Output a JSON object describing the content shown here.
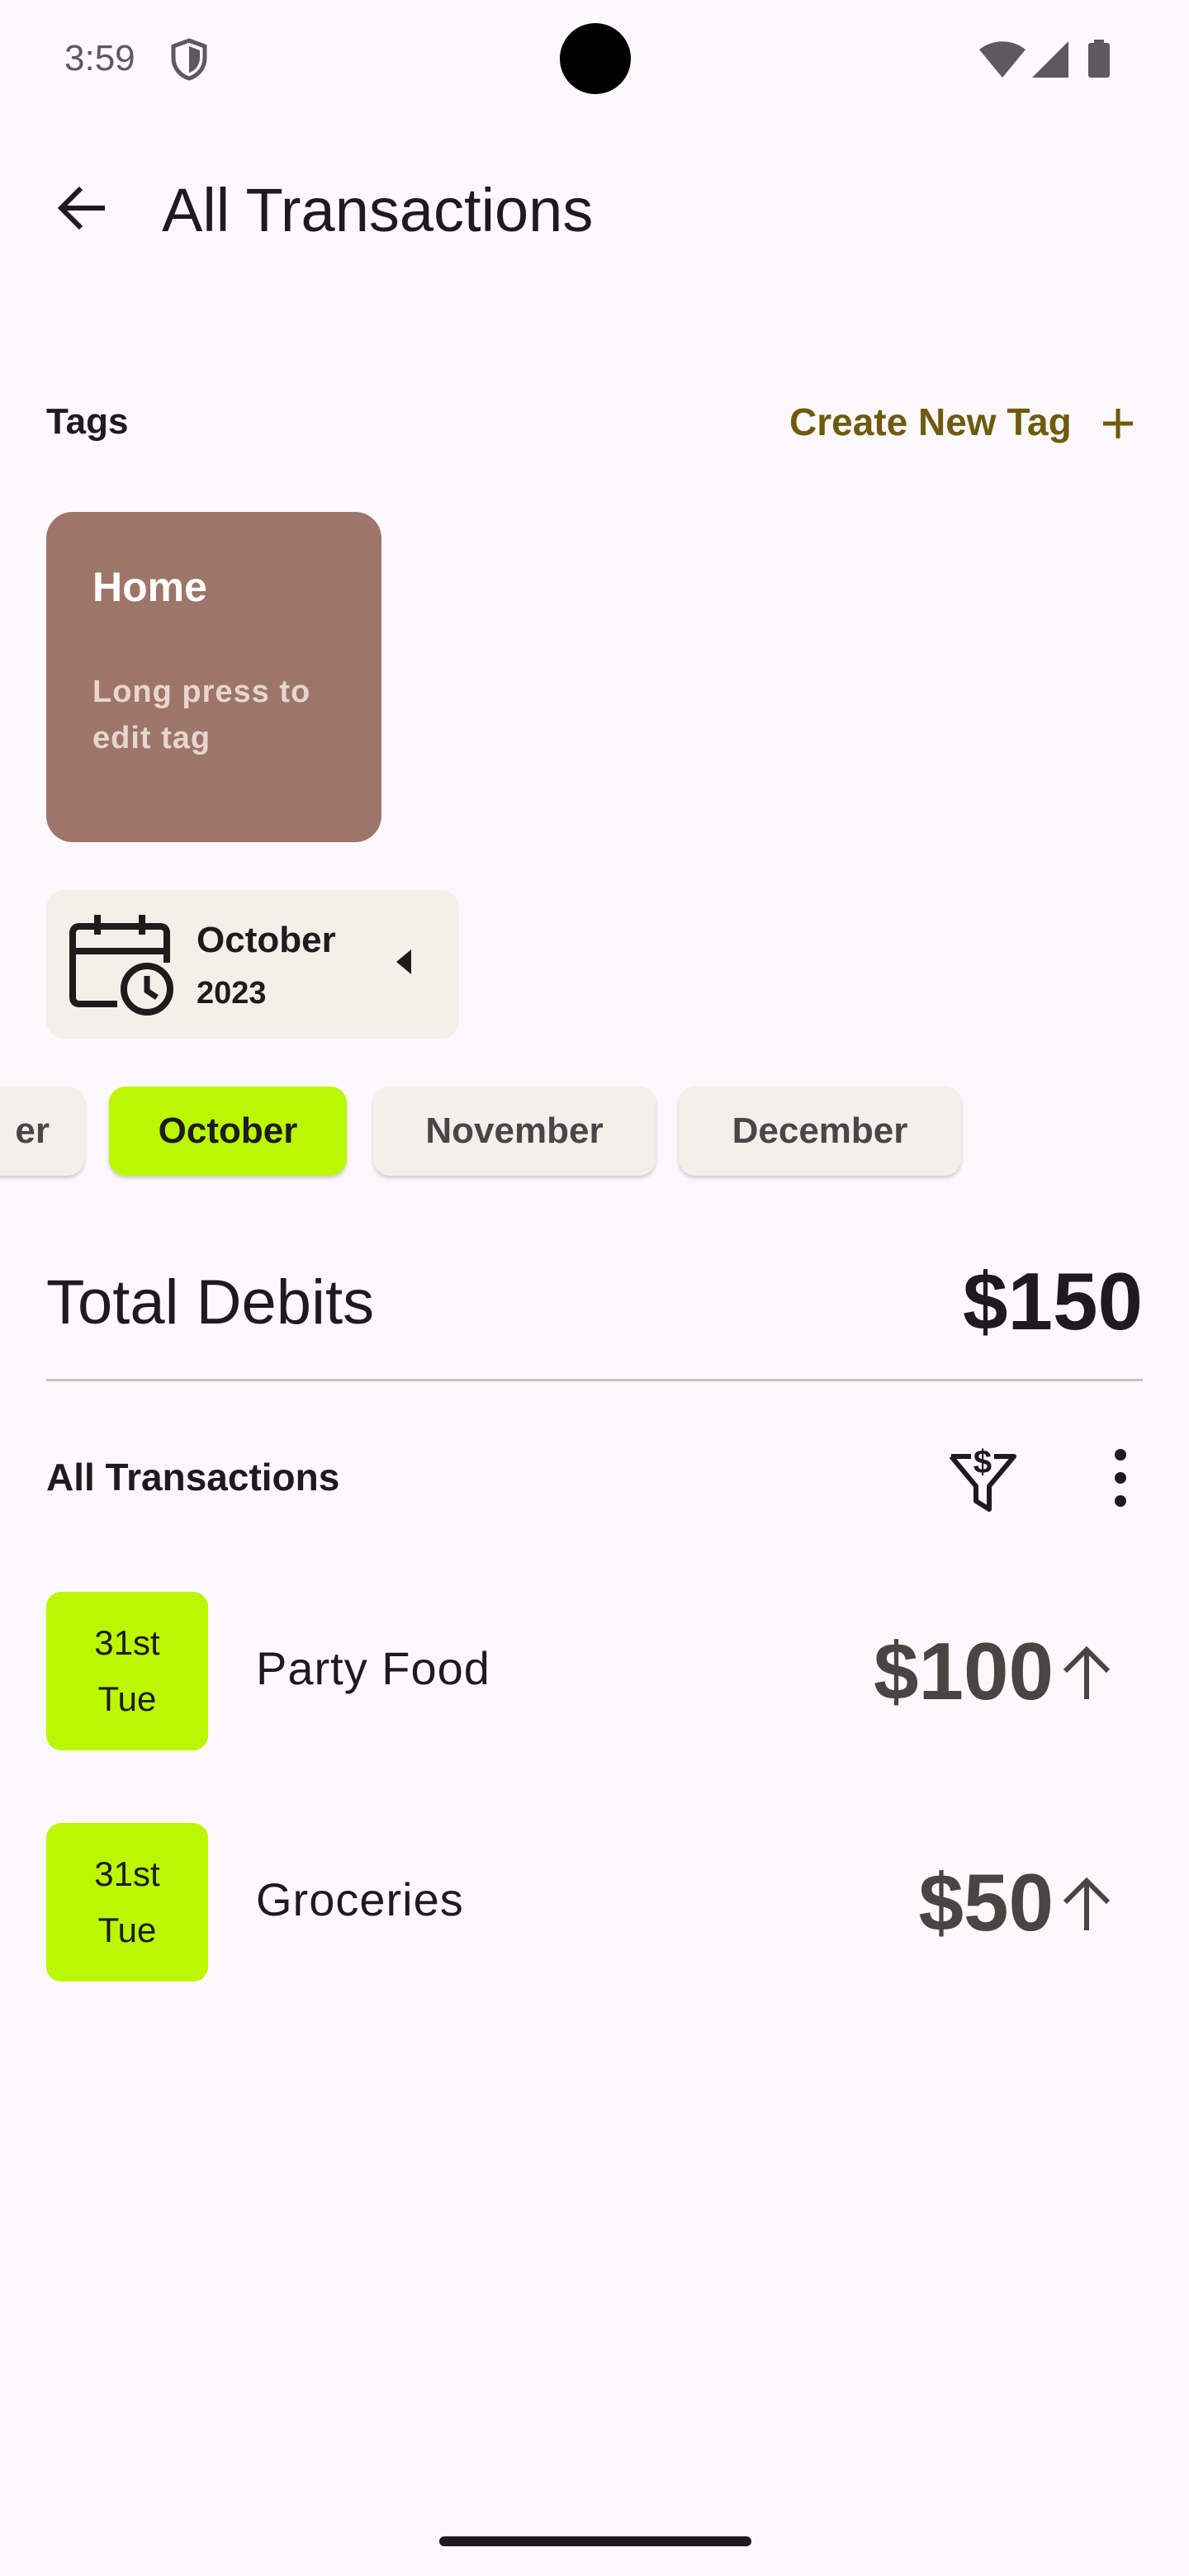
{
  "status_bar": {
    "time": "3:59",
    "icons": [
      "shield-icon",
      "wifi-icon",
      "signal-icon",
      "battery-icon"
    ]
  },
  "app_bar": {
    "back_icon": "arrow-back-icon",
    "title": "All Transactions"
  },
  "tags": {
    "label": "Tags",
    "create_label": "Create New Tag",
    "create_icon": "plus-icon",
    "items": [
      {
        "name": "Home",
        "hint": "Long press to edit tag",
        "color": "#9e7569"
      }
    ]
  },
  "date_picker": {
    "icon": "calendar-clock-icon",
    "month": "October",
    "year": "2023",
    "caret_icon": "caret-left-icon"
  },
  "months": {
    "items": [
      {
        "label": "er",
        "selected": false
      },
      {
        "label": "October",
        "selected": true
      },
      {
        "label": "November",
        "selected": false
      },
      {
        "label": "December",
        "selected": false
      }
    ],
    "selected_color": "#bbf700"
  },
  "summary": {
    "label": "Total Debits",
    "amount": "$150"
  },
  "transactions": {
    "header": "All Transactions",
    "filter_icon": "dollar-filter-icon",
    "more_icon": "more-vert-icon",
    "items": [
      {
        "day": "31st",
        "weekday": "Tue",
        "name": "Party Food",
        "amount": "$100",
        "direction_icon": "arrow-up-icon"
      },
      {
        "day": "31st",
        "weekday": "Tue",
        "name": "Groceries",
        "amount": "$50",
        "direction_icon": "arrow-up-icon"
      }
    ]
  }
}
